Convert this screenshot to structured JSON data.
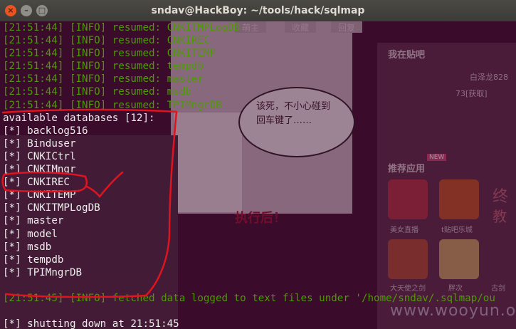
{
  "window": {
    "title": "sndav@HackBoy: ~/tools/hack/sqlmap",
    "buttons": [
      "×",
      "–",
      "□"
    ]
  },
  "background_page": {
    "top_buttons": [
      "萌主",
      "收藏",
      "回复"
    ],
    "bubble_text": "该死，不小心碰到回车键了……",
    "comic_caption": "执行后！",
    "sidebar_heading_1": "我在贴吧",
    "user_name": "白泽龙828",
    "user_points": "73[获取]",
    "sidebar_heading_2": "推荐应用",
    "new_badge": "NEW",
    "app_labels": [
      "美女直播",
      "t贴吧乐城",
      "大天使之剑",
      "胖次"
    ],
    "side_letters": [
      "终",
      "教",
      "古剑"
    ],
    "watermark": "www.wooyun.org"
  },
  "terminal": {
    "resumed": [
      "[21:51:44] [INFO] resumed: CNKITMPLogDB",
      "[21:51:44] [INFO] resumed: CNKIREC",
      "[21:51:44] [INFO] resumed: CNKITEMP",
      "[21:51:44] [INFO] resumed: tempdb",
      "[21:51:44] [INFO] resumed: master",
      "[21:51:44] [INFO] resumed: msdb",
      "[21:51:44] [INFO] resumed: TPIMngrDB"
    ],
    "available_header": "available databases [12]:",
    "databases": [
      "[*] backlog516",
      "[*] Binduser",
      "[*] CNKICtrl",
      "[*] CNKIMngr",
      "[*] CNKIREC",
      "[*] CNKITEMP",
      "[*] CNKITMPLogDB",
      "[*] master",
      "[*] model",
      "[*] msdb",
      "[*] tempdb",
      "[*] TPIMngrDB"
    ],
    "fetched_line": "[21:51:45] [INFO] fetched data logged to text files under '/home/sndav/.sqlmap/ou",
    "shutdown_line": "[*] shutting down at 21:51:45"
  },
  "colors": {
    "info_green": "#4e9a06",
    "text_white": "#eeeeec",
    "annotation_red": "#e0141e",
    "terminal_bg": "#3a0b2b"
  }
}
